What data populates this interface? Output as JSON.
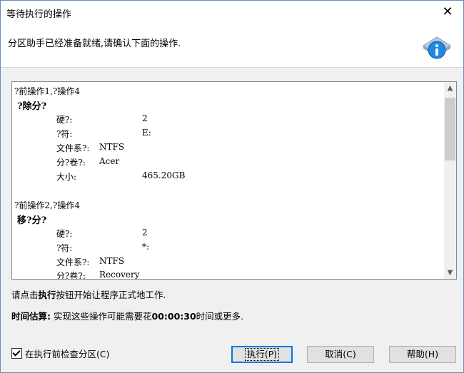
{
  "window": {
    "title": "等待执行的操作",
    "close_glyph": "✕"
  },
  "header": {
    "text": "分区助手已经准备就绪,请确认下面的操作.",
    "icon": "info-icon"
  },
  "operations": [
    {
      "head": "?前操作1,?操作4",
      "title": "?除分?",
      "props": [
        {
          "label": "硬?:",
          "value": "2"
        },
        {
          "label": "?符:",
          "value": "E:"
        },
        {
          "label": "文件系?:",
          "value": "NTFS"
        },
        {
          "label": "分?卷?:",
          "value": "Acer"
        },
        {
          "label": "大小:",
          "value": "465.20GB"
        }
      ]
    },
    {
      "head": "?前操作2,?操作4",
      "title": "移?分?",
      "props": [
        {
          "label": "硬?:",
          "value": "2"
        },
        {
          "label": "?符:",
          "value": "*:"
        },
        {
          "label": "文件系?:",
          "value": "NTFS"
        },
        {
          "label": "分?卷?:",
          "value": "Recovery"
        }
      ]
    }
  ],
  "instruction": {
    "prefix": "请点击",
    "bold": "执行",
    "suffix": "按钮开始让程序正式地工作."
  },
  "estimate": {
    "label": "时间估算:",
    "prefix": " 实现这些操作可能需要花",
    "time": "00:00:30",
    "suffix": "时间或更多."
  },
  "checkbox": {
    "label": "在执行前检查分区(C)",
    "checked": true
  },
  "buttons": {
    "execute": "执行(P)",
    "cancel": "取消(C)",
    "help": "帮助(H)"
  },
  "colors": {
    "accent": "#0078d7",
    "window_border": "#6b8fb5"
  }
}
